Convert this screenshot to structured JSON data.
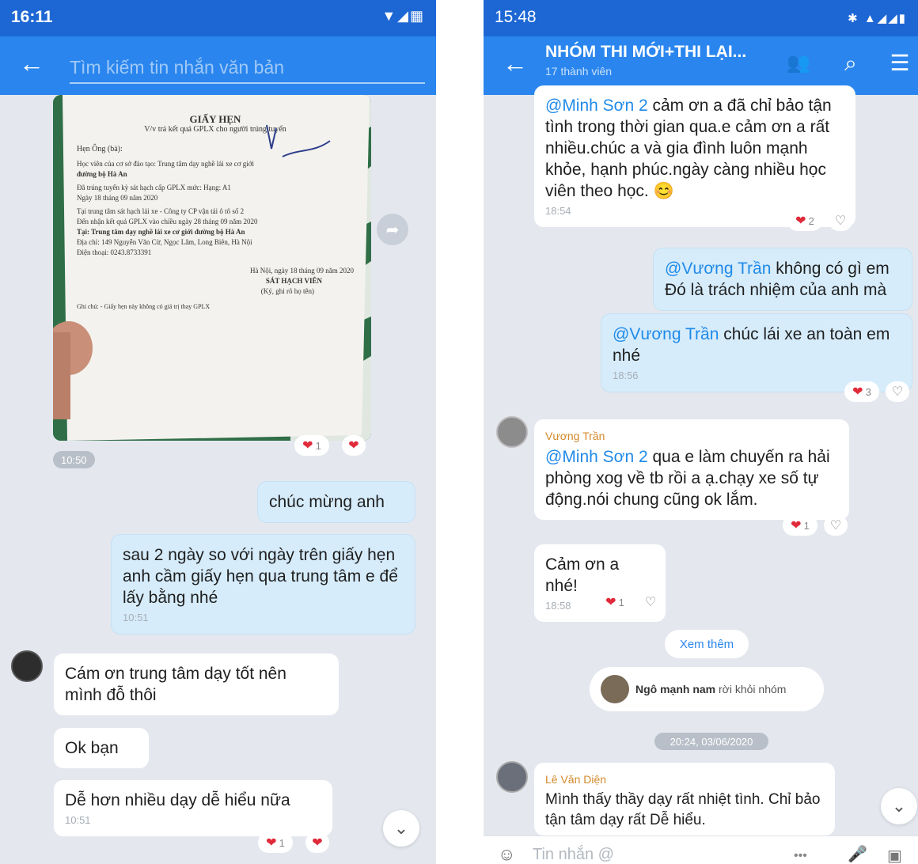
{
  "left": {
    "status": {
      "time": "16:11",
      "icons": "▼◢▦"
    },
    "search": {
      "placeholder": "Tìm kiếm tin nhắn văn bản"
    },
    "photo": {
      "doc_title": "GIẤY HẸN",
      "doc_subtitle": "V/v trả kết quả GPLX cho người trúng tuyển",
      "doc_name_label": "Hẹn Ông (bà):",
      "doc_line1": "Học viên của cơ sở đào tạo: Trung tâm dạy nghề lái xe cơ giới",
      "doc_line2": "đường bộ Hà An",
      "doc_line3": "Đã trúng tuyển kỳ sát hạch cấp GPLX mức: Hạng: A1",
      "doc_line4": "Ngày 18 tháng 09 năm 2020",
      "doc_line5": "Tại trung tâm sát hạch lái xe - Công ty CP vận tải ô tô số 2",
      "doc_line6": "Đến nhận kết quả GPLX vào chiều ngày 28 tháng 09 năm 2020",
      "doc_line7": "Tại: Trung tâm dạy nghề lái xe cơ giới đường bộ Hà An",
      "doc_line8": "Địa chỉ: 149 Nguyễn Văn Cừ, Ngọc Lâm, Long Biên, Hà Nội",
      "doc_line9": "Điện thoại: 0243.8733391",
      "doc_date": "Hà Nội, ngày 18 tháng 09 năm 2020",
      "doc_sign_title": "SÁT HẠCH VIÊN",
      "doc_sign_sub": "(Ký, ghi rõ họ tên)",
      "doc_note": "Ghi chú: - Giấy hẹn này không có giá trị thay GPLX"
    },
    "photo_reaction_count": "1",
    "photo_time": "10:50",
    "out1": "chúc mừng anh",
    "out2": "sau 2 ngày so với ngày trên giấy hẹn anh cầm giấy hẹn qua trung tâm e để lấy bằng nhé",
    "out2_time": "10:51",
    "in1": "Cám ơn trung tâm dạy tốt nên mình đỗ thôi",
    "in2": "Ok bạn",
    "in3": "Dễ hơn nhiều dạy dễ hiểu nữa",
    "in3_time": "10:51",
    "in3_reaction_count": "1"
  },
  "right": {
    "status": {
      "time": "15:48",
      "icons": "✱ ▲◢◢▮"
    },
    "title": "NHÓM THI MỚI+THI LẠI...",
    "subtitle": "17 thành viên",
    "m1_mention": "@Minh Sơn 2",
    "m1_text": " cảm ơn a đã chỉ bảo tận tình trong thời gian qua.e cảm ơn a  rất nhiều.chúc a và gia đình luôn mạnh khỏe, hạnh phúc.ngày càng nhiều học viên theo học. 😊",
    "m1_time": "18:54",
    "m1_react": "2",
    "m2_mention": "@Vương Trần",
    "m2_text": " không có gì em Đó là trách nhiệm của anh mà",
    "m3_mention": "@Vương Trần",
    "m3_text": " chúc lái xe an toàn em nhé",
    "m3_time": "18:56",
    "m3_react": "3",
    "m4_sender": "Vương Trần",
    "m4_mention": "@Minh Sơn 2",
    "m4_text": "  qua e làm chuyến ra hải phòng xog về tb rồi a ạ.chạy xe số tự động.nói chung cũng ok lắm.",
    "m4_react": "1",
    "m5_text": "Cảm ơn a nhé!",
    "m5_time": "18:58",
    "m5_react": "1",
    "see_more": "Xem thêm",
    "system_name": "Ngô mạnh nam",
    "system_text": " rời khỏi nhóm",
    "date_pill": "20:24, 03/06/2020",
    "m6_sender": "Lê Văn Diện",
    "m6_text": "Mình thấy thầy dạy rất nhiệt tình. Chỉ bảo tận tâm dạy rất Dễ hiểu.",
    "compose_placeholder": "Tin nhắn @",
    "compose_more": "•••"
  }
}
